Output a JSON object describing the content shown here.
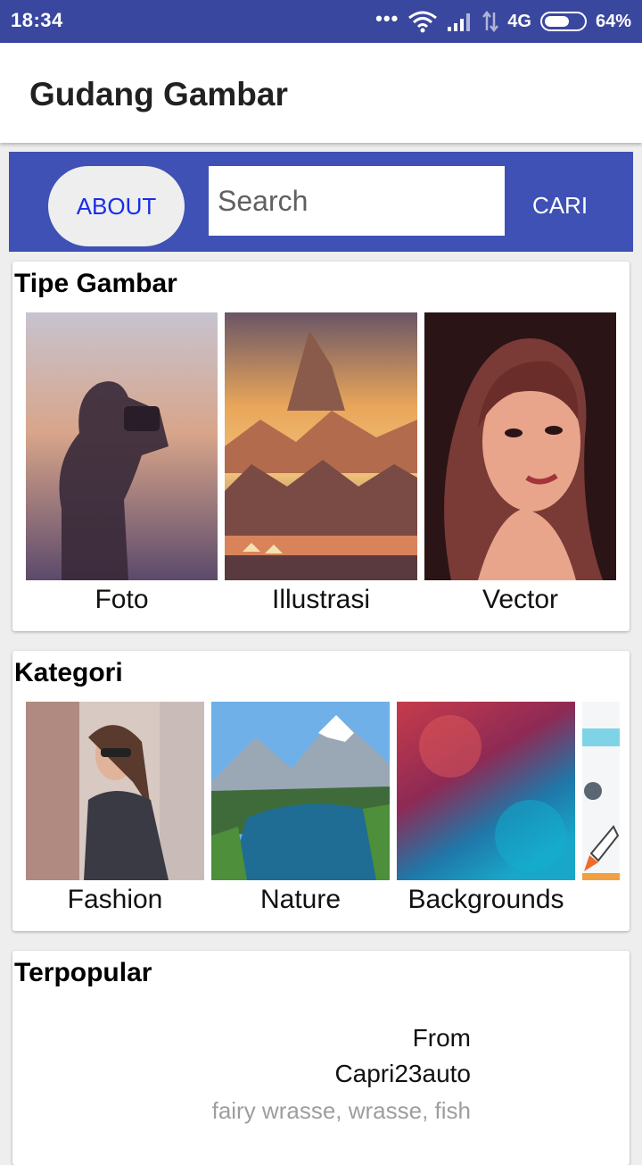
{
  "status_bar": {
    "time": "18:34",
    "signal_dots": "•••",
    "network": "4G",
    "battery_percent": "64%",
    "battery_level": 0.64,
    "icons": [
      "wifi-icon",
      "signal-icon",
      "data-arrows-icon",
      "battery-icon"
    ]
  },
  "app_bar": {
    "title": "Gudang Gambar"
  },
  "search_bar": {
    "about_label": "ABOUT",
    "search_placeholder": "Search",
    "search_value": "",
    "cari_label": "CARI",
    "accent_color": "#3f51b5",
    "about_text_color": "#1a2de8"
  },
  "tipe_gambar": {
    "title": "Tipe Gambar",
    "items": [
      {
        "label": "Foto",
        "image": "photographer-silhouette"
      },
      {
        "label": "Illustrasi",
        "image": "mountain-illustration"
      },
      {
        "label": "Vector",
        "image": "woman-vector-portrait"
      }
    ]
  },
  "kategori": {
    "title": "Kategori",
    "items": [
      {
        "label": "Fashion",
        "image": "fashion-woman-sunglasses"
      },
      {
        "label": "Nature",
        "image": "mountain-lake"
      },
      {
        "label": "Backgrounds",
        "image": "watercolor-background"
      },
      {
        "label": "",
        "image": "science-rocket-microscope"
      }
    ]
  },
  "terpopular": {
    "title": "Terpopular",
    "from_prefix": "From",
    "author": "Capri23auto",
    "tags": "fairy wrasse, wrasse, fish"
  }
}
